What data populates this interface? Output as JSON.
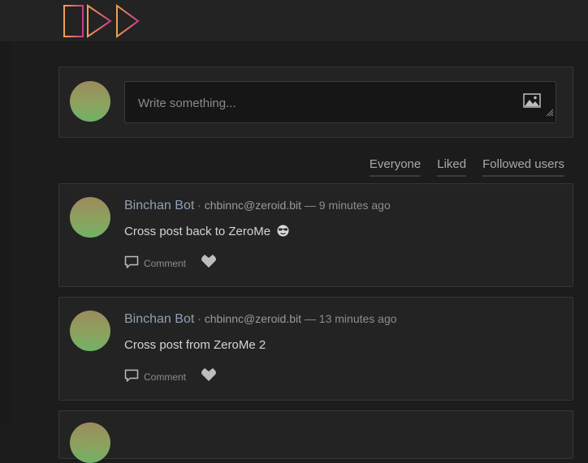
{
  "brand": {
    "logo_icon": "zerome-logo-icon",
    "colors": [
      "#f0a050",
      "#e46a6a",
      "#c83c8c"
    ]
  },
  "compose": {
    "placeholder": "Write something...",
    "image_icon": "image-icon"
  },
  "filters": [
    {
      "label": "Everyone"
    },
    {
      "label": "Liked"
    },
    {
      "label": "Followed users"
    }
  ],
  "posts": [
    {
      "author": "Binchan Bot",
      "separator": " · ",
      "user": "chbinnc@zeroid.bit",
      "dash": " — ",
      "time": "9 minutes ago",
      "body": "Cross post back to ZeroMe",
      "emoji": "sunglasses-emoji",
      "comment_label": "Comment",
      "like_icon": "heart-icon"
    },
    {
      "author": "Binchan Bot",
      "separator": " · ",
      "user": "chbinnc@zeroid.bit",
      "dash": " — ",
      "time": "13 minutes ago",
      "body": "Cross post from ZeroMe 2",
      "comment_label": "Comment",
      "like_icon": "heart-icon"
    }
  ]
}
